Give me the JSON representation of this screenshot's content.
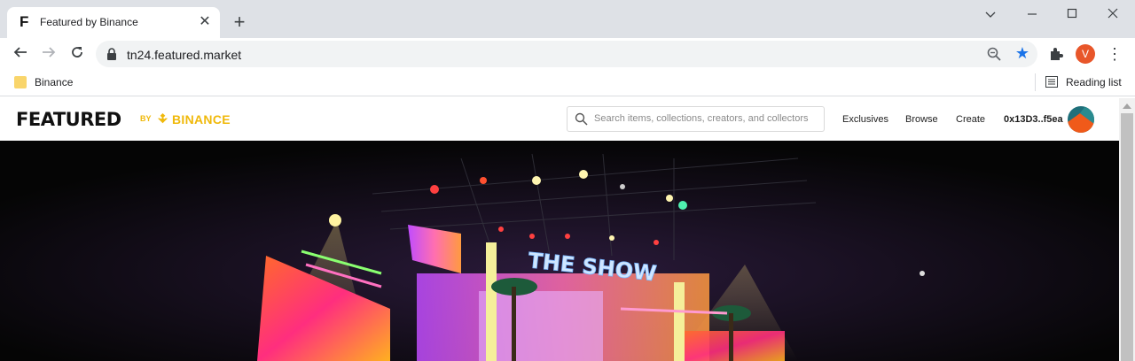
{
  "browser": {
    "tab_title": "Featured by Binance",
    "tab_favicon": "F",
    "url": "tn24.featured.market",
    "profile_initial": "V",
    "bookmark": "Binance",
    "reading_list": "Reading list",
    "icons": [
      "back-arrow-icon",
      "forward-arrow-icon",
      "reload-icon",
      "lock-icon",
      "zoom-icon",
      "star-icon",
      "extensions-icon",
      "menu-icon",
      "minimize-icon",
      "maximize-icon",
      "close-icon",
      "chevron-down-icon"
    ],
    "colors": {
      "tabstrip": "#dee1e6",
      "accent": "#1a73e8",
      "profile": "#e8562a"
    }
  },
  "site": {
    "logo_main": "FEATURED",
    "logo_by": "BY",
    "logo_brand": "BINANCE",
    "search_placeholder": "Search items, collections, creators, and collectors",
    "nav": [
      "Exclusives",
      "Browse",
      "Create"
    ],
    "wallet": "0x13D3..f5ea",
    "hero_sign": "THE SHOW",
    "colors": {
      "brand": "#f0b90b",
      "text": "#1e1e1e"
    }
  }
}
